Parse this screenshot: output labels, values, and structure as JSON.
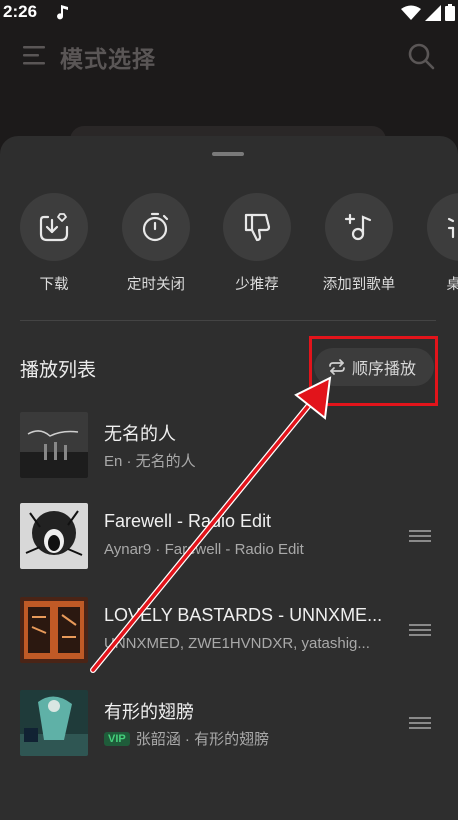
{
  "status_bar": {
    "time": "2:26"
  },
  "background": {
    "title": "模式选择"
  },
  "actions": [
    {
      "label": "下载",
      "icon": "download-icon"
    },
    {
      "label": "定时关闭",
      "icon": "timer-icon"
    },
    {
      "label": "少推荐",
      "icon": "thumbs-down-icon"
    },
    {
      "label": "添加到歌单",
      "icon": "add-to-playlist-icon"
    },
    {
      "label": "桌面",
      "icon": "desktop-lyrics-icon"
    }
  ],
  "playlist": {
    "title": "播放列表",
    "order_label": "顺序播放",
    "songs": [
      {
        "title": "无名的人",
        "subtitle": "En · 无名的人",
        "vip": false
      },
      {
        "title": "Farewell - Radio Edit",
        "subtitle": "Aynar9 · Farewell - Radio Edit",
        "vip": false
      },
      {
        "title": "LOVELY BASTARDS - UNNXME...",
        "subtitle": "UNNXMED, ZWE1HVNDXR, yatashig...",
        "vip": false
      },
      {
        "title": "有形的翅膀",
        "subtitle": "张韶涵 · 有形的翅膀",
        "vip": true,
        "vip_label": "VIP"
      }
    ]
  },
  "colors": {
    "highlight": "#e2141b",
    "sheet": "#2e2e2e",
    "vip_text": "#45d07c"
  }
}
